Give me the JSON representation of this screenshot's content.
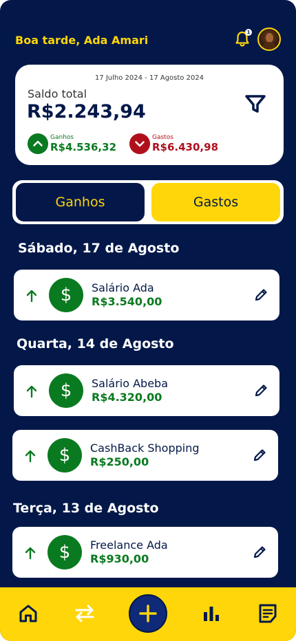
{
  "header": {
    "greeting": "Boa tarde, Ada Amari",
    "notification_count": "1"
  },
  "balance": {
    "period": "17 Julho 2024 - 17 Agosto 2024",
    "label": "Saldo total",
    "value": "R$2.243,94",
    "gains_label": "Ganhos",
    "gains_value": "R$4.536,32",
    "expenses_label": "Gastos",
    "expenses_value": "R$6.430,98"
  },
  "toggle": {
    "gains_label": "Ganhos",
    "expenses_label": "Gastos"
  },
  "groups": [
    {
      "date": "Sábado, 17 de Agosto",
      "items": [
        {
          "name": "Salário Ada",
          "value": "R$3.540,00",
          "icon": "$"
        }
      ]
    },
    {
      "date": "Quarta, 14 de Agosto",
      "items": [
        {
          "name": "Salário Abeba",
          "value": "R$4.320,00",
          "icon": "$"
        },
        {
          "name": "CashBack Shopping",
          "value": "R$250,00",
          "icon": "$"
        }
      ]
    },
    {
      "date": "Terça, 13 de Agosto",
      "items": [
        {
          "name": "Freelance Ada",
          "value": "R$930,00",
          "icon": "$"
        }
      ]
    }
  ],
  "nav": {
    "items": [
      "home-icon",
      "transfer-icon",
      "add-icon",
      "chart-icon",
      "report-icon"
    ]
  },
  "colors": {
    "background": "#031849",
    "accent": "#FFD60A",
    "gain": "#0A7A20",
    "loss": "#B0101C"
  }
}
